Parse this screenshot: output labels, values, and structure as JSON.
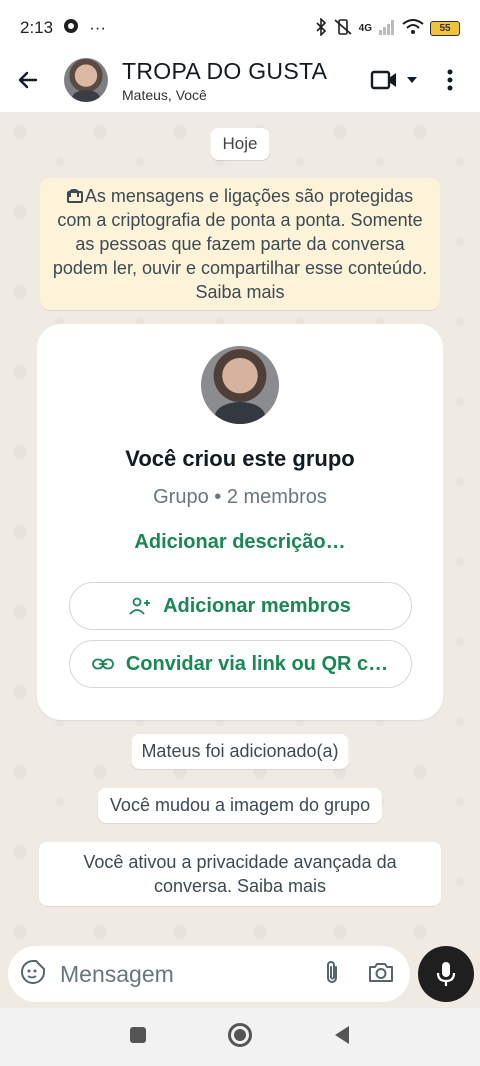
{
  "status_bar": {
    "time": "2:13",
    "dots": "···",
    "battery": "55",
    "network": "4G"
  },
  "header": {
    "title": "TROPA DO GUSTA",
    "subtitle": "Mateus, Você"
  },
  "chat": {
    "date_chip": "Hoje",
    "encryption_notice": "As mensagens e ligações são protegidas com a criptografia de ponta a ponta. Somente as pessoas que fazem parte da conversa podem ler, ouvir e compartilhar esse conteúdo. Saiba mais",
    "group_card": {
      "title": "Você criou este grupo",
      "subtitle": "Grupo • 2 membros",
      "add_description": "Adicionar descrição…",
      "add_members": "Adicionar membros",
      "invite_link": "Convidar via link ou QR c…"
    },
    "system_messages": [
      "Mateus foi adicionado(a)",
      "Você mudou a imagem do grupo",
      "Você ativou a privacidade avançada da conversa. Saiba mais"
    ]
  },
  "composer": {
    "placeholder": "Mensagem"
  },
  "colors": {
    "accent_green": "#1a8754",
    "chat_bg": "#efeae2",
    "encryption_bg": "#fdf3d9",
    "mic_bg": "#1f1f1f"
  }
}
